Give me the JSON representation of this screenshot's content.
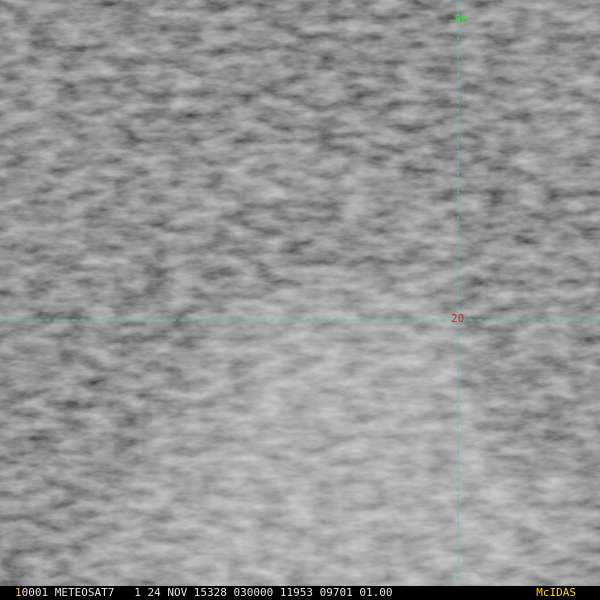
{
  "image": {
    "grid_lat_label": "-80",
    "grid_lon_label": "20",
    "colors": {
      "grid": "#3fc8c8",
      "lat_label": "#3fdc3f",
      "lon_label": "#c82a2a",
      "frame": "#ffd400",
      "status_text": "#e8e8e8"
    }
  },
  "status_bar": {
    "frame": "1",
    "info": "0001 METEOSAT7   1 24 NOV 15328 030000 11953 09701 01.00",
    "brand": "McIDAS"
  }
}
